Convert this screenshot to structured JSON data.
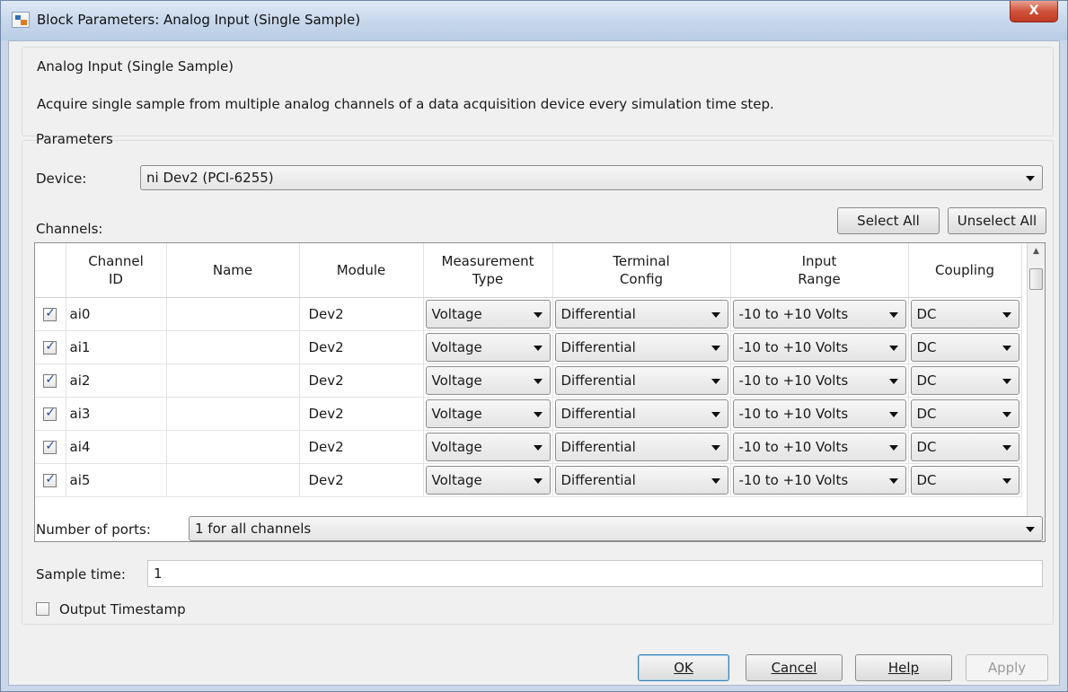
{
  "window": {
    "title": "Block Parameters: Analog Input (Single Sample)",
    "close_label": "X"
  },
  "description": {
    "title": "Analog Input (Single Sample)",
    "text": "Acquire single sample from multiple analog channels of a data acquisition device every simulation time step."
  },
  "parameters": {
    "group_label": "Parameters",
    "device_label": "Device:",
    "device_value": "ni Dev2 (PCI-6255)",
    "channels_label": "Channels:",
    "select_all_label": "Select All",
    "unselect_all_label": "Unselect All"
  },
  "table": {
    "headers": {
      "channel_id": "Channel\nID",
      "name": "Name",
      "module": "Module",
      "measurement_type": "Measurement\nType",
      "terminal_config": "Terminal\nConfig",
      "input_range": "Input\nRange",
      "coupling": "Coupling"
    },
    "rows": [
      {
        "checked": true,
        "channel_id": "ai0",
        "name": "",
        "module": "Dev2",
        "measurement_type": "Voltage",
        "terminal_config": "Differential",
        "input_range": "-10 to +10 Volts",
        "coupling": "DC"
      },
      {
        "checked": true,
        "channel_id": "ai1",
        "name": "",
        "module": "Dev2",
        "measurement_type": "Voltage",
        "terminal_config": "Differential",
        "input_range": "-10 to +10 Volts",
        "coupling": "DC"
      },
      {
        "checked": true,
        "channel_id": "ai2",
        "name": "",
        "module": "Dev2",
        "measurement_type": "Voltage",
        "terminal_config": "Differential",
        "input_range": "-10 to +10 Volts",
        "coupling": "DC"
      },
      {
        "checked": true,
        "channel_id": "ai3",
        "name": "",
        "module": "Dev2",
        "measurement_type": "Voltage",
        "terminal_config": "Differential",
        "input_range": "-10 to +10 Volts",
        "coupling": "DC"
      },
      {
        "checked": true,
        "channel_id": "ai4",
        "name": "",
        "module": "Dev2",
        "measurement_type": "Voltage",
        "terminal_config": "Differential",
        "input_range": "-10 to +10 Volts",
        "coupling": "DC"
      },
      {
        "checked": true,
        "channel_id": "ai5",
        "name": "",
        "module": "Dev2",
        "measurement_type": "Voltage",
        "terminal_config": "Differential",
        "input_range": "-10 to +10 Volts",
        "coupling": "DC"
      }
    ]
  },
  "ports": {
    "label": "Number of ports:",
    "value": "1 for all channels"
  },
  "sample_time": {
    "label": "Sample time:",
    "value": "1"
  },
  "output_timestamp": {
    "label": "Output Timestamp",
    "checked": false
  },
  "buttons": {
    "ok": "OK",
    "cancel": "Cancel",
    "help": "Help",
    "apply": "Apply"
  },
  "icons": {
    "app": "simulink-block-icon",
    "close": "close-icon",
    "dropdown": "chevron-down-icon"
  }
}
